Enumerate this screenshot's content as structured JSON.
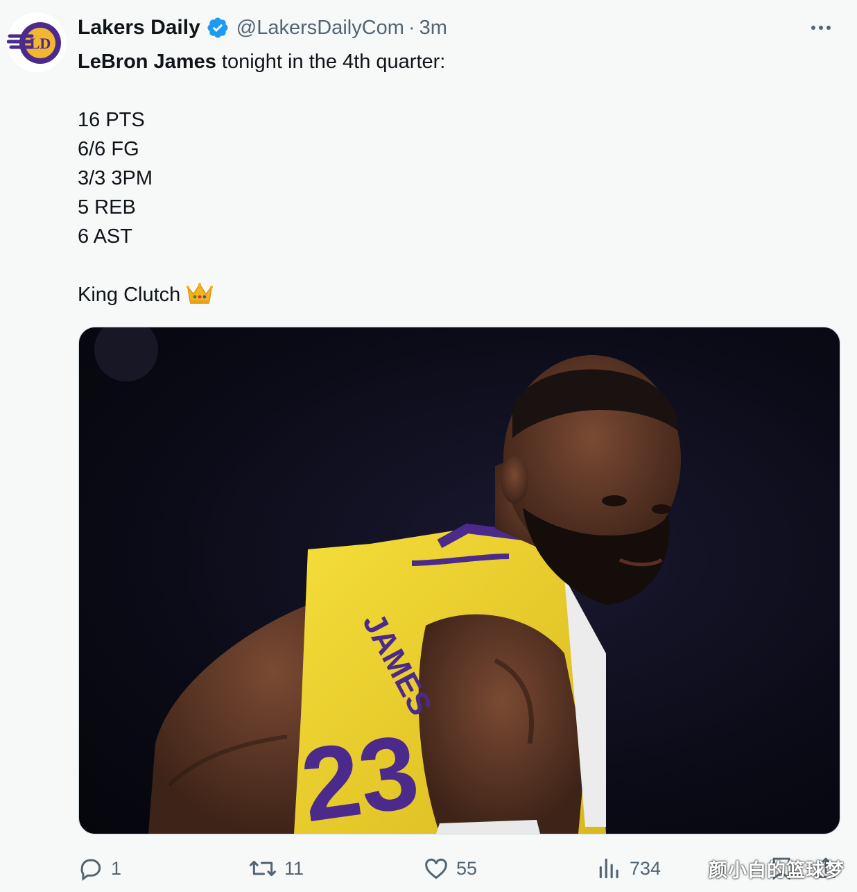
{
  "account": {
    "display_name": "Lakers Daily",
    "handle": "@LakersDailyCom",
    "separator": "·",
    "time": "3m",
    "avatar_text": "LAKERS DAILY"
  },
  "tweet": {
    "intro_bold": "LeBron James",
    "intro_rest": " tonight in the 4th quarter:",
    "stats": [
      "16 PTS",
      "6/6 FG",
      "3/3 3PM",
      "5 REB",
      "6 AST"
    ],
    "closing": "King Clutch",
    "closing_emoji": "crown-emoji"
  },
  "media": {
    "jersey_name": "JAMES",
    "jersey_number": "23",
    "colors": {
      "jersey": "#f2d62c",
      "trim": "#4b2a8c",
      "background": "#0b0b17"
    }
  },
  "actions": {
    "replies": "1",
    "retweets": "11",
    "likes": "55",
    "views": "734"
  },
  "icons": [
    "verified-badge-icon",
    "more-options-icon",
    "reply-icon",
    "retweet-icon",
    "like-icon",
    "views-icon",
    "bookmark-icon",
    "share-icon"
  ],
  "colors": {
    "verified": "#1d9bf0",
    "text": "#0f1419",
    "secondary": "#536471",
    "background": "#f7f9f9"
  },
  "watermark": "颜小白的篮球梦"
}
